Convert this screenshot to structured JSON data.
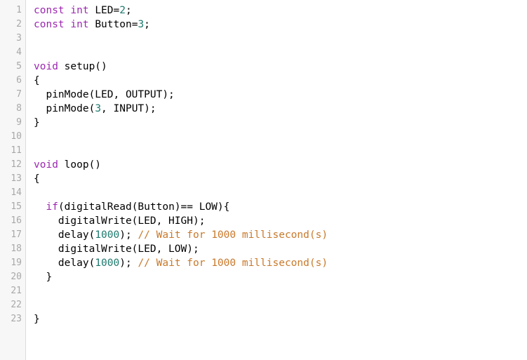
{
  "editor": {
    "name": "arduino-sketch-code-editor",
    "language": "arduino-c",
    "background_color": "#ffffff",
    "gutter_background_color": "#f7f7f7",
    "gutter_border_color": "#dcdcdc",
    "line_number_color": "#a8a8a8",
    "total_lines": 23
  },
  "syntax_colors": {
    "keyword": "#9c27b0",
    "number": "#1d7a6e",
    "comment": "#c8792b",
    "plain": "#000000"
  },
  "lines": [
    {
      "number": "1",
      "text": "const int LED=2;",
      "tokens": [
        {
          "t": "const",
          "k": "keyword"
        },
        {
          "t": " ",
          "k": "plain"
        },
        {
          "t": "int",
          "k": "keyword"
        },
        {
          "t": " LED=",
          "k": "plain"
        },
        {
          "t": "2",
          "k": "number"
        },
        {
          "t": ";",
          "k": "plain"
        }
      ]
    },
    {
      "number": "2",
      "text": "const int Button=3;",
      "tokens": [
        {
          "t": "const",
          "k": "keyword"
        },
        {
          "t": " ",
          "k": "plain"
        },
        {
          "t": "int",
          "k": "keyword"
        },
        {
          "t": " Button=",
          "k": "plain"
        },
        {
          "t": "3",
          "k": "number"
        },
        {
          "t": ";",
          "k": "plain"
        }
      ]
    },
    {
      "number": "3",
      "text": "",
      "tokens": []
    },
    {
      "number": "4",
      "text": "",
      "tokens": []
    },
    {
      "number": "5",
      "text": "void setup()",
      "tokens": [
        {
          "t": "void",
          "k": "keyword"
        },
        {
          "t": " setup()",
          "k": "plain"
        }
      ]
    },
    {
      "number": "6",
      "text": "{",
      "tokens": [
        {
          "t": "{",
          "k": "plain"
        }
      ]
    },
    {
      "number": "7",
      "text": "  pinMode(LED, OUTPUT);",
      "tokens": [
        {
          "t": "  pinMode(LED, OUTPUT);",
          "k": "plain"
        }
      ]
    },
    {
      "number": "8",
      "text": "  pinMode(3, INPUT);",
      "tokens": [
        {
          "t": "  pinMode(",
          "k": "plain"
        },
        {
          "t": "3",
          "k": "number"
        },
        {
          "t": ", INPUT);",
          "k": "plain"
        }
      ]
    },
    {
      "number": "9",
      "text": "}",
      "tokens": [
        {
          "t": "}",
          "k": "plain"
        }
      ]
    },
    {
      "number": "10",
      "text": "",
      "tokens": []
    },
    {
      "number": "11",
      "text": "",
      "tokens": []
    },
    {
      "number": "12",
      "text": "void loop()",
      "tokens": [
        {
          "t": "void",
          "k": "keyword"
        },
        {
          "t": " loop()",
          "k": "plain"
        }
      ]
    },
    {
      "number": "13",
      "text": "{",
      "tokens": [
        {
          "t": "{",
          "k": "plain"
        }
      ]
    },
    {
      "number": "14",
      "text": "",
      "tokens": []
    },
    {
      "number": "15",
      "text": "  if(digitalRead(Button)== LOW){",
      "tokens": [
        {
          "t": "  ",
          "k": "plain"
        },
        {
          "t": "if",
          "k": "keyword"
        },
        {
          "t": "(digitalRead(Button)== LOW){",
          "k": "plain"
        }
      ]
    },
    {
      "number": "16",
      "text": "    digitalWrite(LED, HIGH);",
      "tokens": [
        {
          "t": "    digitalWrite(LED, HIGH);",
          "k": "plain"
        }
      ]
    },
    {
      "number": "17",
      "text": "    delay(1000); // Wait for 1000 millisecond(s)",
      "tokens": [
        {
          "t": "    delay(",
          "k": "plain"
        },
        {
          "t": "1000",
          "k": "number"
        },
        {
          "t": "); ",
          "k": "plain"
        },
        {
          "t": "// Wait for 1000 millisecond(s)",
          "k": "comment"
        }
      ]
    },
    {
      "number": "18",
      "text": "    digitalWrite(LED, LOW);",
      "tokens": [
        {
          "t": "    digitalWrite(LED, LOW);",
          "k": "plain"
        }
      ]
    },
    {
      "number": "19",
      "text": "    delay(1000); // Wait for 1000 millisecond(s)",
      "tokens": [
        {
          "t": "    delay(",
          "k": "plain"
        },
        {
          "t": "1000",
          "k": "number"
        },
        {
          "t": "); ",
          "k": "plain"
        },
        {
          "t": "// Wait for 1000 millisecond(s)",
          "k": "comment"
        }
      ]
    },
    {
      "number": "20",
      "text": "  }",
      "tokens": [
        {
          "t": "  }",
          "k": "plain"
        }
      ]
    },
    {
      "number": "21",
      "text": "",
      "tokens": []
    },
    {
      "number": "22",
      "text": "",
      "tokens": []
    },
    {
      "number": "23",
      "text": "}",
      "tokens": [
        {
          "t": "}",
          "k": "plain"
        }
      ]
    }
  ]
}
